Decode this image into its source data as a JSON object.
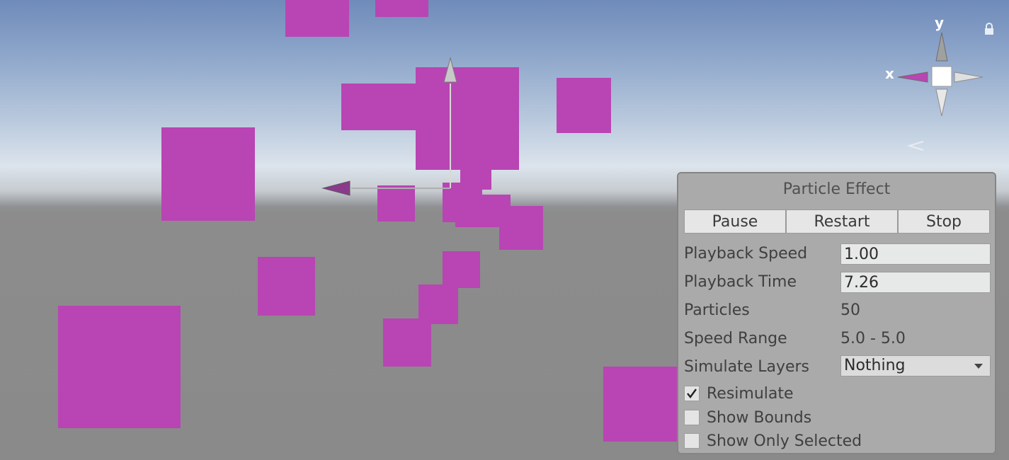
{
  "panel": {
    "title": "Particle Effect",
    "buttons": [
      "Pause",
      "Restart",
      "Stop"
    ],
    "playback_speed": {
      "label": "Playback Speed",
      "value": "1.00"
    },
    "playback_time": {
      "label": "Playback Time",
      "value": "7.26"
    },
    "particles": {
      "label": "Particles",
      "value": "50"
    },
    "speed_range": {
      "label": "Speed Range",
      "value": "5.0 - 5.0"
    },
    "simulate_layers": {
      "label": "Simulate Layers",
      "value": "Nothing"
    },
    "checkboxes": [
      {
        "label": "Resimulate",
        "checked": true
      },
      {
        "label": "Show Bounds",
        "checked": false
      },
      {
        "label": "Show Only Selected",
        "checked": false
      }
    ]
  },
  "gizmo": {
    "x_label": "x",
    "y_label": "y"
  },
  "colors": {
    "particle": "#b845b3",
    "panel_bg": "#aaaaaa",
    "sky_top": "#6f8bb9",
    "ground": "#8a8a8a"
  },
  "icons": [
    "scene-orientation-gizmo-icon",
    "lock-icon",
    "move-tool-arrow-icon",
    "checkmark-icon",
    "dropdown-arrow-icon"
  ]
}
